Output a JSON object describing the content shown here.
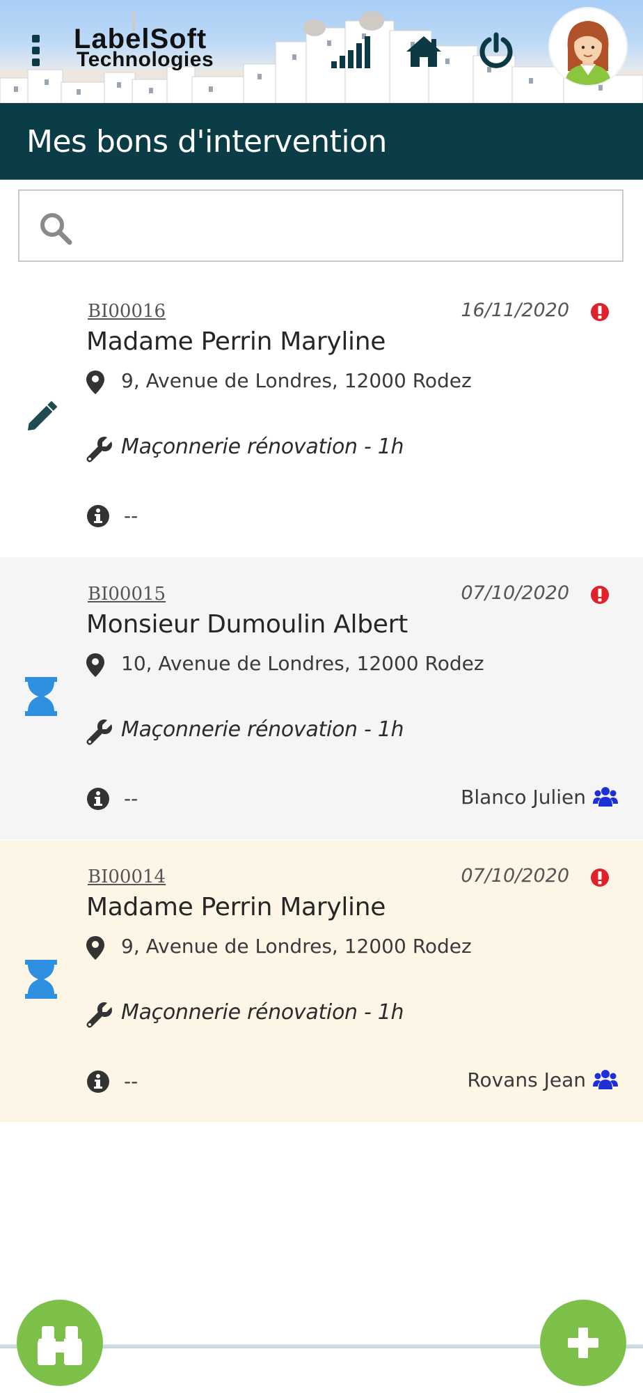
{
  "app": {
    "logo": {
      "line1": "LabelSoft",
      "line2": "Technologies"
    },
    "icons": {
      "menu": "vertical-dots",
      "signal": "signal-bars-icon",
      "home": "home-icon",
      "power": "power-icon",
      "avatar": "user-avatar"
    }
  },
  "header": {
    "title": "Mes bons d'intervention"
  },
  "search": {
    "placeholder": "",
    "value": ""
  },
  "colors": {
    "header_bg": "#0b3d47",
    "accent_green": "#7cc04a",
    "alert_red": "#e0212b",
    "status_blue": "#2f8fe0",
    "team_blue": "#1e2fd6"
  },
  "interventions": [
    {
      "ref": "BI00016",
      "date": "16/11/2020",
      "client": "Madame Perrin Maryline",
      "address": "9, Avenue de Londres, 12000 Rodez",
      "task": "Maçonnerie rénovation - 1h",
      "note": "--",
      "assignee": "",
      "status_icon": "pencil-icon"
    },
    {
      "ref": "BI00015",
      "date": "07/10/2020",
      "client": "Monsieur Dumoulin Albert",
      "address": "10, Avenue de Londres, 12000 Rodez",
      "task": "Maçonnerie rénovation - 1h",
      "note": "--",
      "assignee": "Blanco Julien",
      "status_icon": "hourglass-icon"
    },
    {
      "ref": "BI00014",
      "date": "07/10/2020",
      "client": "Madame Perrin Maryline",
      "address": "9, Avenue de Londres, 12000 Rodez",
      "task": "Maçonnerie rénovation - 1h",
      "note": "--",
      "assignee": "Rovans Jean",
      "status_icon": "hourglass-icon"
    }
  ],
  "fabs": {
    "left": "binoculars-icon",
    "right": "plus-icon"
  }
}
